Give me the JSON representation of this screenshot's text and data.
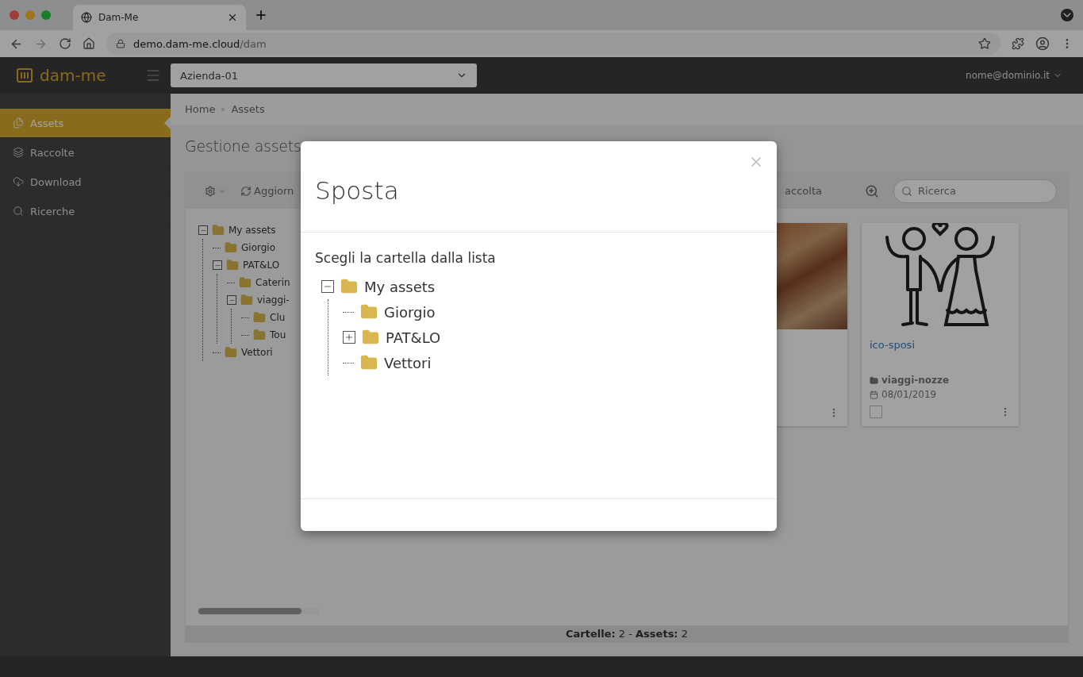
{
  "browser": {
    "tab_title": "Dam-Me",
    "url_host": "demo.dam-me.cloud",
    "url_path": "/dam"
  },
  "header": {
    "logo_text": "dam-me",
    "company": "Azienda-01",
    "user": "nome@dominio.it"
  },
  "sidebar": {
    "items": [
      {
        "label": "Assets",
        "selected": true
      },
      {
        "label": "Raccolte",
        "selected": false
      },
      {
        "label": "Download",
        "selected": false
      },
      {
        "label": "Ricerche",
        "selected": false
      }
    ]
  },
  "breadcrumb": [
    "Home",
    "Assets"
  ],
  "page_title": "Gestione assets",
  "toolbar": {
    "refresh_label": "Aggiorn",
    "collection_label": "accolta",
    "search_placeholder": "Ricerca"
  },
  "folder_tree": [
    {
      "label": "My assets",
      "expanded": true,
      "children": [
        {
          "label": "Giorgio"
        },
        {
          "label": "PAT&LO",
          "expanded": true,
          "children": [
            {
              "label": "Caterin"
            },
            {
              "label": "viaggi-",
              "expanded": true,
              "children": [
                {
                  "label": "Clu"
                },
                {
                  "label": "Tou"
                }
              ]
            }
          ]
        },
        {
          "label": "Vettori"
        }
      ]
    }
  ],
  "cards": [
    {
      "kind": "photo"
    },
    {
      "kind": "drawing",
      "title": "ico-sposi",
      "folder": "viaggi-nozze",
      "date": "08/01/2019",
      "checked": false
    }
  ],
  "status_text": "**Cartelle:** 2 - **Assets:** 2",
  "modal": {
    "title": "Sposta",
    "prompt": "Scegli la cartella dalla lista",
    "tree": [
      {
        "label": "My assets",
        "expanded": true,
        "children": [
          {
            "label": "Giorgio"
          },
          {
            "label": "PAT&LO",
            "expanded": false
          },
          {
            "label": "Vettori"
          }
        ]
      }
    ]
  }
}
